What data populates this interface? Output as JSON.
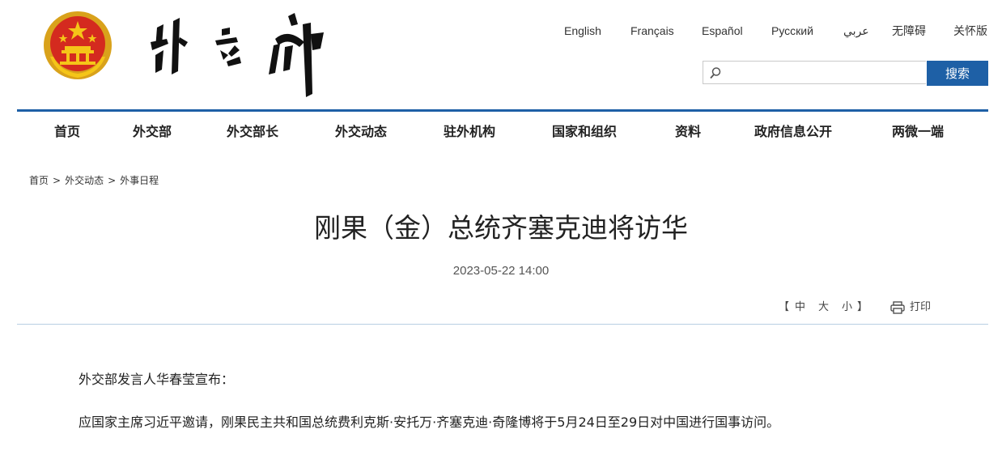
{
  "header": {
    "emblem_icon": "national-emblem-icon",
    "logo_text": "外交部",
    "languages": [
      "English",
      "Français",
      "Español",
      "Русский",
      "عربي",
      "无障碍",
      "关怀版"
    ],
    "search": {
      "placeholder": "",
      "value": "",
      "button_label": "搜索",
      "icon": "search-icon"
    },
    "accent_color": "#1e60a6"
  },
  "nav": {
    "items": [
      "首页",
      "外交部",
      "外交部长",
      "外交动态",
      "驻外机构",
      "国家和组织",
      "资料",
      "政府信息公开",
      "两微一端"
    ]
  },
  "breadcrumb": {
    "items": [
      "首页",
      "外交动态",
      "外事日程"
    ],
    "separator": ">"
  },
  "article": {
    "title": "刚果（金）总统齐塞克迪将访华",
    "date": "2023-05-22 14:00",
    "font_controls": {
      "open": "【",
      "large": "中",
      "medium": "大",
      "small": "小",
      "close": "】"
    },
    "print_label": "打印",
    "print_icon": "printer-icon",
    "paragraphs": [
      "外交部发言人华春莹宣布：",
      "应国家主席习近平邀请，刚果民主共和国总统费利克斯·安托万·齐塞克迪·奇隆博将于5月24日至29日对中国进行国事访问。"
    ]
  }
}
